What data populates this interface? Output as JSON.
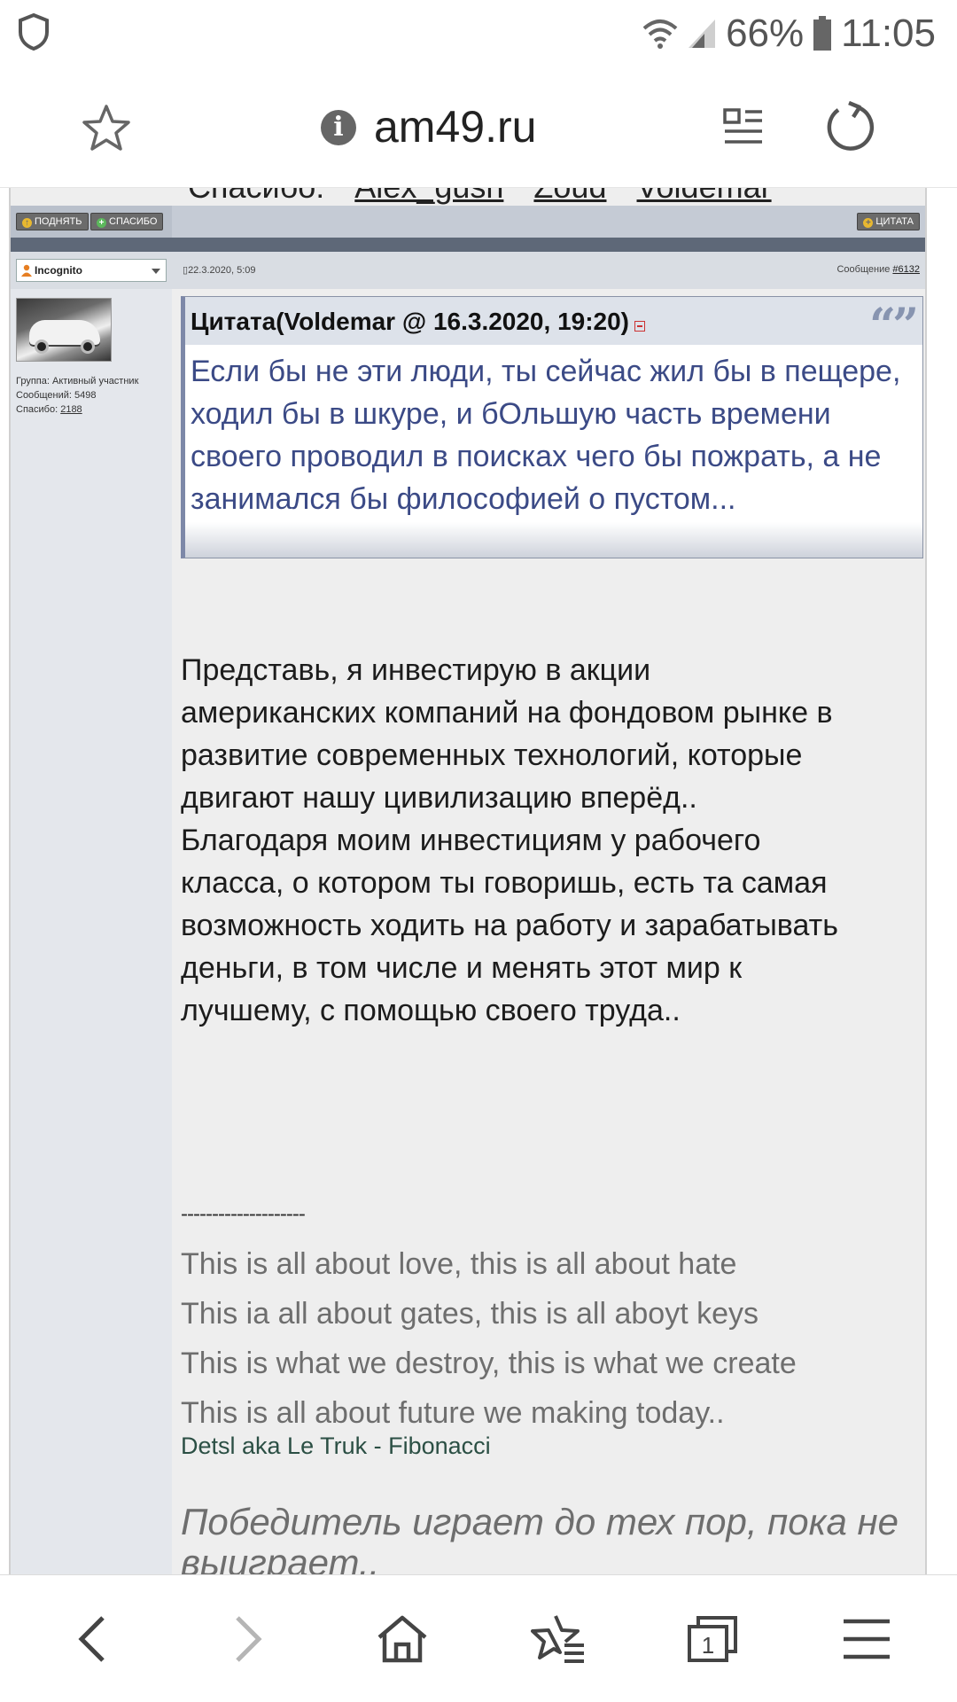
{
  "status_bar": {
    "battery": "66%",
    "time": "11:05",
    "icons": [
      "shield-icon",
      "wifi-icon",
      "signal-icon",
      "battery-icon"
    ]
  },
  "toolbar": {
    "url": "am49.ru",
    "icons": [
      "bookmark-star-icon",
      "info-icon",
      "reader-mode-icon",
      "reload-icon"
    ]
  },
  "post": {
    "prev_thanks_line": "Спасибо:",
    "prev_thanks_users": [
      "Alex_gush",
      "Zoud",
      "Voldemar"
    ],
    "actions": {
      "up_label": "ПОДНЯТЬ",
      "thanks_label": "СПАСИБО",
      "quote_label": "ЦИТАТА"
    },
    "author": "Incognito",
    "date": "22.3.2020, 5:09",
    "message_label": "Сообщение",
    "message_number": "#6132",
    "user_info": {
      "group": "Группа: Активный участник",
      "posts": "Сообщений: 5498",
      "thanks_label": "Спасибо:",
      "thanks_count": "2188"
    },
    "quote": {
      "title": "Цитата(Voldemar @ 16.3.2020, 19:20)",
      "text": "Если бы не эти люди, ты сейчас жил бы в пещере, ходил бы в шкуре, и бОльшую часть времени своего проводил в поисках чего бы пожрать, а не занимался бы философией о пустом..."
    },
    "body_lines": [
      "Представь, я инвестирую в акции",
      "американских компаний на фондовом рынке в",
      "развитие современных технологий, которые",
      "двигают нашу цивилизацию вперёд..",
      "Благодаря моим инвестициям у рабочего",
      "класса, о котором ты говоришь, есть та самая",
      "возможность ходить на работу и зарабатывать",
      "деньги, в том числе и менять этот мир к",
      "лучшему, с помощью своего труда.."
    ],
    "signature": {
      "separator": "--------------------",
      "lines": [
        "This is all about love, this is all about hate",
        "This ia all about gates, this is all aboyt keys",
        "This is what we destroy, this is what we create",
        "This is all about future we making today.."
      ],
      "credit": "Detsl aka Le Truk - Fibonacci",
      "motto": "Победитель играет до тех пор, пока не выиграет.."
    }
  },
  "bottom_nav": {
    "tabs_count": "1",
    "icons": [
      "back-icon",
      "forward-icon",
      "home-icon",
      "bookmarks-icon",
      "tabs-icon",
      "menu-icon"
    ]
  }
}
